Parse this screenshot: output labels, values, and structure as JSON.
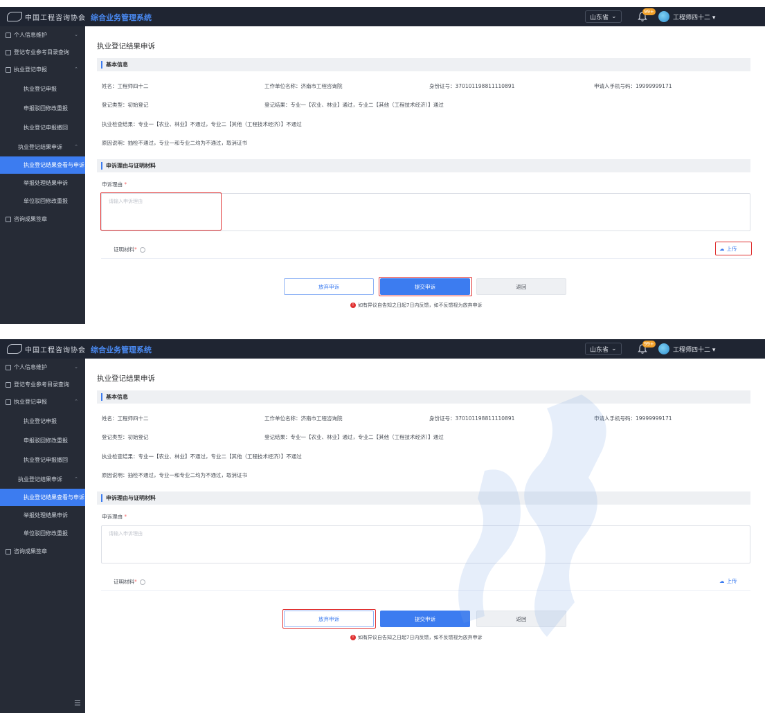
{
  "header": {
    "logo_text": "中国工程咨询协会",
    "app_title": "综合业务管理系统",
    "province": "山东省",
    "notification_count": "99+",
    "user_name": "工程师四十二"
  },
  "sidebar": {
    "items": [
      {
        "label": "个人信息维护"
      },
      {
        "label": "登记专业参考目录查询"
      },
      {
        "label": "执业登记申报"
      },
      {
        "label": "执业登记申报"
      },
      {
        "label": "申报驳回修改重报"
      },
      {
        "label": "执业登记申报撤回"
      },
      {
        "label": "执业登记结果申诉"
      },
      {
        "label": "执业登记结果查看与申诉"
      },
      {
        "label": "举报处理结果申诉"
      },
      {
        "label": "单位驳回修改重报"
      },
      {
        "label": "咨询成果签章"
      }
    ]
  },
  "page": {
    "title": "执业登记结果申诉",
    "basic_section": "基本信息",
    "name": "姓名：工程师四十二",
    "work_unit": "工作单位名称：济南市工程咨询院",
    "id_number": "身份证号：370101198811110891",
    "phone": "申请人手机号码：19999999171",
    "reg_type": "登记类型：初始登记",
    "reg_result": "登记结果：专业一【农业、林业】通过，专业二【其他（工程技术经济）】通过",
    "check_result": "执业检查结果：专业一【农业、林业】不通过，专业二【其他（工程技术经济）】不通过",
    "reason_note": "原因说明：抽检不通过，专业一和专业二均为不通过，取消证书",
    "appeal_section": "申诉理由与证明材料",
    "appeal_reason_label": "申诉理由",
    "required_mark": "*",
    "textarea_placeholder": "请输入申诉理由",
    "proof_label": "证明材料",
    "upload_label": "上传",
    "abandon_button": "放弃申诉",
    "submit_button": "提交申诉",
    "back_button": "返回",
    "notice_text": "如有异议自告知之日起7日内反馈，如不反馈视为放弃申诉"
  },
  "colors": {
    "accent": "#3c7cf0",
    "header_bg": "#1f2532",
    "sidebar_bg": "#262b36",
    "highlight": "#e03131"
  }
}
